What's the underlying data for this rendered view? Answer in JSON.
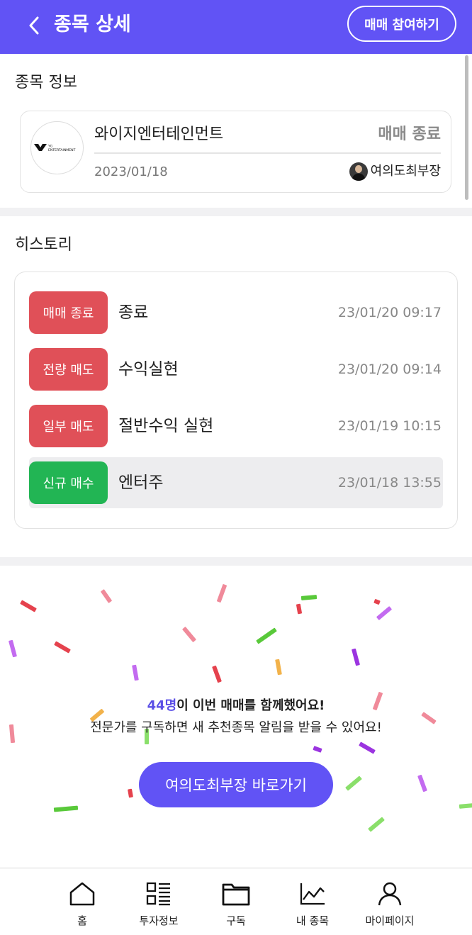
{
  "header": {
    "title": "종목 상세",
    "join_button": "매매 참여하기"
  },
  "stock_info": {
    "section_title": "종목 정보",
    "name": "와이지엔터테인먼트",
    "status": "매매 종료",
    "date": "2023/01/18",
    "expert_name": "여의도최부장",
    "logo_text": "ENTERTAINMENT",
    "logo_small_text": "YG"
  },
  "history": {
    "section_title": "히스토리",
    "rows": [
      {
        "badge": "매매 종료",
        "text": "종료",
        "time": "23/01/20 09:17",
        "badge_color": "#e05058",
        "selected": false
      },
      {
        "badge": "전량 매도",
        "text": "수익실현",
        "time": "23/01/20 09:14",
        "badge_color": "#e05058",
        "selected": false
      },
      {
        "badge": "일부 매도",
        "text": "절반수익 실현",
        "time": "23/01/19 10:15",
        "badge_color": "#e05058",
        "selected": false
      },
      {
        "badge": "신규 매수",
        "text": "엔터주",
        "time": "23/01/18 13:55",
        "badge_color": "#22b554",
        "selected": true
      }
    ]
  },
  "promo": {
    "count": "44명",
    "line1_rest": "이 이번 매매를 함께했어요!",
    "line2": "전문가를 구독하면 새 추천종목 알림을 받을 수 있어요!",
    "button": "여의도최부장 바로가기"
  },
  "nav": {
    "items": [
      {
        "label": "홈",
        "icon": "home-icon"
      },
      {
        "label": "투자정보",
        "icon": "list-icon"
      },
      {
        "label": "구독",
        "icon": "folder-icon"
      },
      {
        "label": "내 종목",
        "icon": "chart-icon"
      },
      {
        "label": "마이페이지",
        "icon": "person-icon"
      }
    ]
  },
  "colors": {
    "brand": "#6153f5",
    "sell_badge": "#e05058",
    "buy_badge": "#22b554",
    "confetti": [
      "#e5424d",
      "#f08a9a",
      "#c36bf0",
      "#59c93a",
      "#f2b24a",
      "#9b34e0",
      "#8adf6a"
    ]
  }
}
